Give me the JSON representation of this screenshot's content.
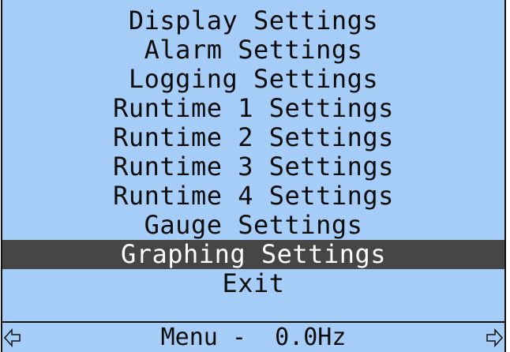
{
  "menu": {
    "items": [
      {
        "label": "Display Settings"
      },
      {
        "label": "Alarm Settings"
      },
      {
        "label": "Logging Settings"
      },
      {
        "label": "Runtime 1 Settings"
      },
      {
        "label": "Runtime 2 Settings"
      },
      {
        "label": "Runtime 3 Settings"
      },
      {
        "label": "Runtime 4 Settings"
      },
      {
        "label": "Gauge Settings"
      },
      {
        "label": "Graphing Settings"
      },
      {
        "label": "Exit"
      }
    ],
    "selected_label": "Graphing Settings"
  },
  "status": {
    "text": "Menu -  0.0Hz",
    "left_icon": "arrow-left-icon",
    "right_icon": "arrow-right-icon"
  },
  "colors": {
    "background": "#a6cdf7",
    "highlight": "#464646",
    "text": "#0c0c0c",
    "highlight_text": "#ffffff"
  }
}
